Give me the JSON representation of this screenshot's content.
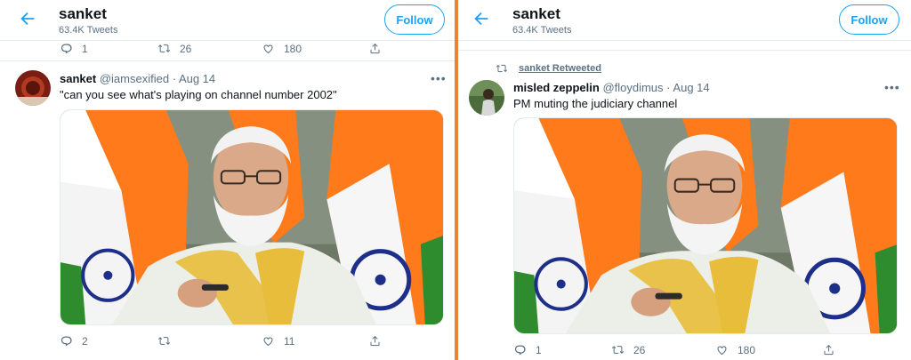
{
  "left": {
    "header": {
      "name": "sanket",
      "tweets": "63.4K Tweets",
      "follow_label": "Follow"
    },
    "prev_actions": {
      "replies": "1",
      "retweets": "26",
      "likes": "180"
    },
    "tweet": {
      "name": "sanket",
      "handle": "@iamsexified",
      "date": "Aug 14",
      "text": "\"can you see what's playing on channel number 2002\"",
      "more": "•••",
      "actions": {
        "replies": "2",
        "retweets": "",
        "likes": "11"
      }
    }
  },
  "right": {
    "header": {
      "name": "sanket",
      "tweets": "63.4K Tweets",
      "follow_label": "Follow"
    },
    "retweeted_by": "sanket Retweeted",
    "tweet": {
      "name": "misled zeppelin",
      "handle": "@floydimus",
      "date": "Aug 14",
      "text": "PM muting the judiciary channel",
      "more": "•••",
      "actions": {
        "replies": "1",
        "retweets": "26",
        "likes": "180"
      }
    }
  },
  "colors": {
    "accent": "#1da1f2",
    "divider": "#e8833a",
    "muted": "#5b7083"
  },
  "icons": [
    "back-arrow-icon",
    "reply-icon",
    "retweet-icon",
    "like-icon",
    "share-icon",
    "more-icon"
  ]
}
